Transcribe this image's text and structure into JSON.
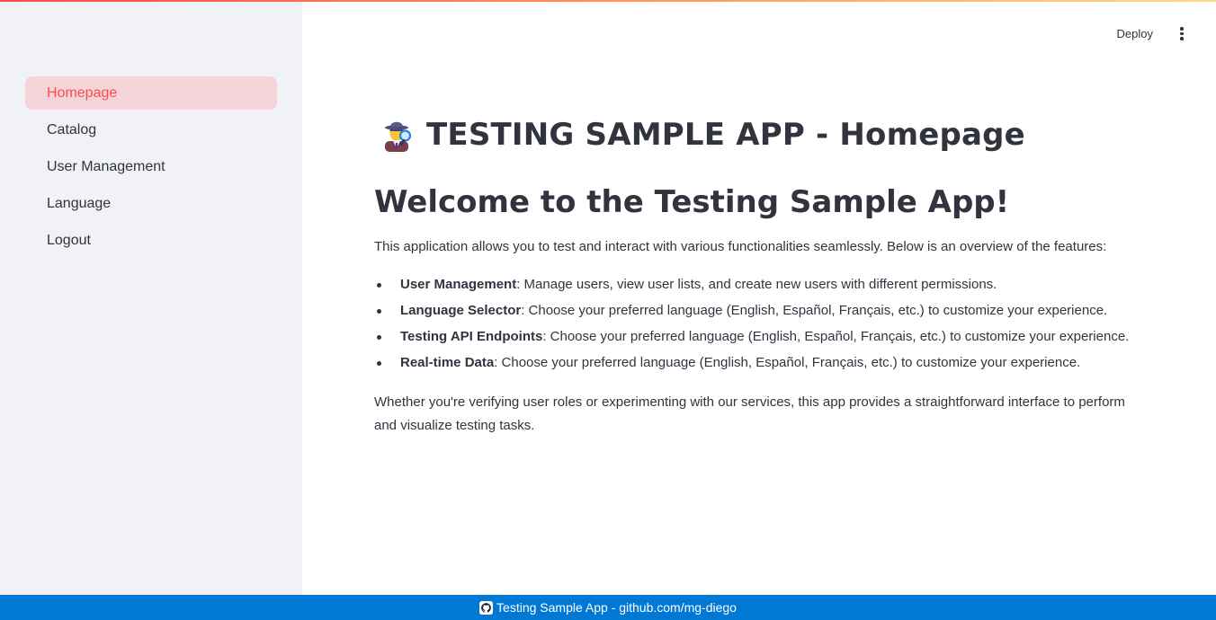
{
  "sidebar": {
    "items": [
      {
        "label": "Homepage",
        "active": true
      },
      {
        "label": "Catalog"
      },
      {
        "label": "User Management"
      },
      {
        "label": "Language"
      },
      {
        "label": "Logout"
      }
    ]
  },
  "header": {
    "deploy_label": "Deploy",
    "menu_icon": "kebab-menu-icon"
  },
  "main": {
    "title_icon": "detective-emoji-icon",
    "title": "TESTING SAMPLE APP - Homepage",
    "welcome_heading": "Welcome to the Testing Sample App!",
    "intro": "This application allows you to test and interact with various functionalities seamlessly. Below is an overview of the features:",
    "features": [
      {
        "name": "User Management",
        "desc": ": Manage users, view user lists, and create new users with different permissions."
      },
      {
        "name": "Language Selector",
        "desc": ": Choose your preferred language (English, Español, Français, etc.) to customize your experience."
      },
      {
        "name": "Testing API Endpoints",
        "desc": ": Choose your preferred language (English, Español, Français, etc.) to customize your experience."
      },
      {
        "name": "Real-time Data",
        "desc": ": Choose your preferred language (English, Español, Français, etc.) to customize your experience."
      }
    ],
    "outro": "Whether you're verifying user roles or experimenting with our services, this app provides a straightforward interface to perform and visualize testing tasks."
  },
  "footer": {
    "icon": "github-icon",
    "text": "Testing Sample App - github.com/mg-diego"
  },
  "colors": {
    "accent": "#ff4b4b",
    "active_nav_bg": "#f5d4d9",
    "sidebar_bg": "#f0f2f6",
    "footer_bg": "#0078d4",
    "text": "#31333f"
  }
}
